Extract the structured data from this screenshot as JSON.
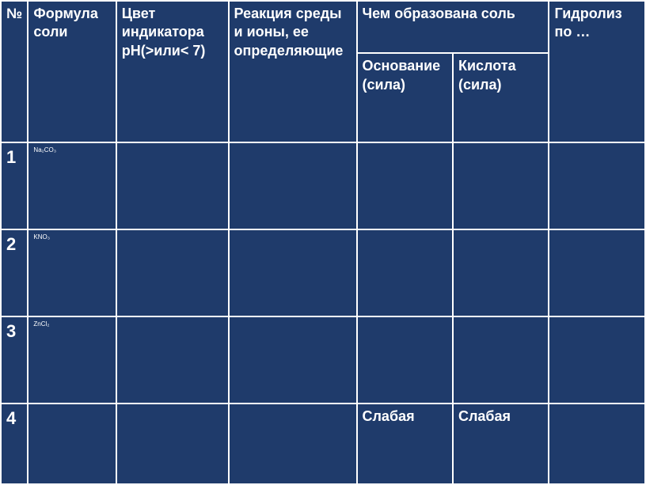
{
  "headers": {
    "num": "№",
    "formula": "Формула соли",
    "color": "Цвет индикатора рН(>или< 7)",
    "reaction": "Реакция среды и ионы, ее определяющие",
    "salt_formed": "Чем образована соль",
    "base": "Основание (сила)",
    "acid": "Кислота (сила)",
    "hydrolysis": "Гидролиз по …"
  },
  "rows": [
    {
      "num": "1",
      "formula": "Na₂CO₃",
      "color": "",
      "reaction": "",
      "base": "",
      "acid": "",
      "hydro": ""
    },
    {
      "num": "2",
      "formula": "KNO₃",
      "color": "",
      "reaction": "",
      "base": "",
      "acid": "",
      "hydro": ""
    },
    {
      "num": "3",
      "formula": "ZnCl₂",
      "color": "",
      "reaction": "",
      "base": "",
      "acid": "",
      "hydro": ""
    },
    {
      "num": "4",
      "formula": "",
      "color": "",
      "reaction": "",
      "base": "Слабая",
      "acid": "Слабая",
      "hydro": ""
    }
  ]
}
